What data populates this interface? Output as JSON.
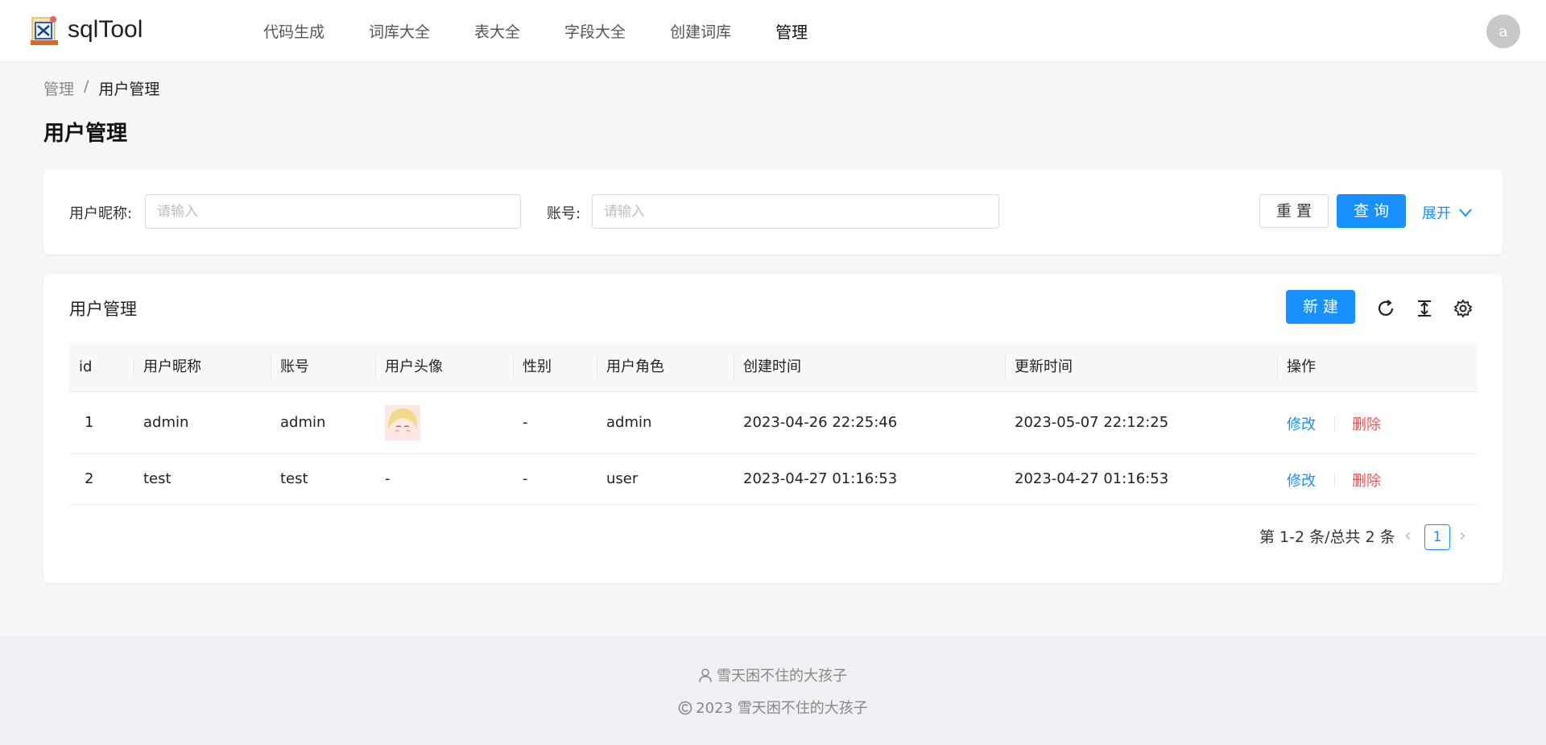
{
  "app": {
    "name": "sqlTool"
  },
  "nav": {
    "items": [
      "代码生成",
      "词库大全",
      "表大全",
      "字段大全",
      "创建词库",
      "管理"
    ],
    "active": "管理"
  },
  "user": {
    "avatar_initial": "a"
  },
  "breadcrumb": {
    "parent": "管理",
    "separator": "/",
    "current": "用户管理"
  },
  "page": {
    "title": "用户管理"
  },
  "search": {
    "nickname_label": "用户昵称:",
    "nickname_placeholder": "请输入",
    "account_label": "账号:",
    "account_placeholder": "请输入",
    "reset_label": "重 置",
    "query_label": "查 询",
    "expand_label": "展开"
  },
  "table": {
    "title": "用户管理",
    "new_label": "新 建",
    "columns": [
      "id",
      "用户昵称",
      "账号",
      "用户头像",
      "性别",
      "用户角色",
      "创建时间",
      "更新时间",
      "操作"
    ],
    "rows": [
      {
        "id": "1",
        "nickname": "admin",
        "account": "admin",
        "avatar": "image",
        "gender": "-",
        "role": "admin",
        "created": "2023-04-26 22:25:46",
        "updated": "2023-05-07 22:12:25",
        "edit": "修改",
        "delete": "删除"
      },
      {
        "id": "2",
        "nickname": "test",
        "account": "test",
        "avatar": "-",
        "gender": "-",
        "role": "user",
        "created": "2023-04-27 01:16:53",
        "updated": "2023-04-27 01:16:53",
        "edit": "修改",
        "delete": "删除"
      }
    ]
  },
  "pagination": {
    "summary": "第 1-2 条/总共 2 条",
    "current": "1"
  },
  "footer": {
    "author": "雪天困不住的大孩子",
    "copyright": "2023 雪天困不住的大孩子"
  },
  "colors": {
    "primary": "#1890ff",
    "danger": "#ff4d4f"
  }
}
